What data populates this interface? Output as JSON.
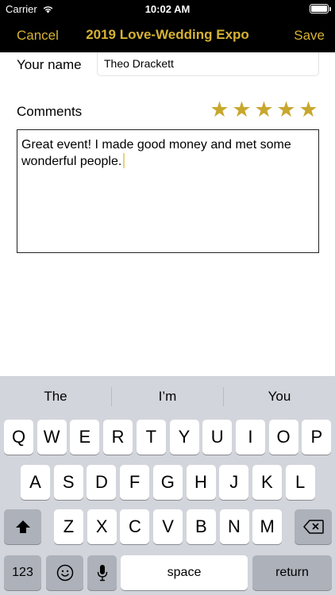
{
  "status_bar": {
    "carrier": "Carrier",
    "time": "10:02 AM",
    "battery_level": 1.0
  },
  "nav": {
    "cancel": "Cancel",
    "title": "2019 Love-Wedding Expo",
    "save": "Save"
  },
  "form": {
    "name_label": "Your name",
    "name_value": "Theo Drackett",
    "comments_label": "Comments",
    "rating": 5,
    "rating_max": 5,
    "comment_text": "Great event! I made good money and met some wonderful people."
  },
  "colors": {
    "accent": "#d6b233",
    "star": "#c8a72e"
  },
  "keyboard": {
    "suggestions": [
      "The",
      "I’m",
      "You"
    ],
    "row1": [
      "Q",
      "W",
      "E",
      "R",
      "T",
      "Y",
      "U",
      "I",
      "O",
      "P"
    ],
    "row2": [
      "A",
      "S",
      "D",
      "F",
      "G",
      "H",
      "J",
      "K",
      "L"
    ],
    "row3": [
      "Z",
      "X",
      "C",
      "V",
      "B",
      "N",
      "M"
    ],
    "numbers_key": "123",
    "space_key": "space",
    "return_key": "return"
  }
}
